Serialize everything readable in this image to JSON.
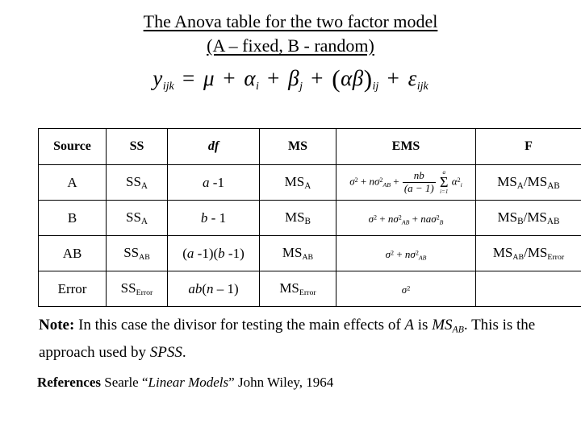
{
  "slide": {
    "title_line1": "The Anova table for the two factor model",
    "title_line2": "(A – fixed, B - random)",
    "equation_plain": "y_ijk = μ + α_i + β_j + (αβ)_ij + ε_ijk",
    "equation_parts": {
      "y": "y",
      "y_sub": "ijk",
      "equals": "=",
      "mu": "μ",
      "plus": "+",
      "alpha": "α",
      "alpha_sub": "i",
      "beta": "β",
      "beta_sub": "j",
      "open_paren": "(",
      "ab_alpha": "α",
      "ab_beta": "β",
      "close_paren": ")",
      "ab_sub": "ij",
      "epsilon": "ε",
      "epsilon_sub": "ijk"
    }
  },
  "table": {
    "headers": {
      "source": "Source",
      "ss": "SS",
      "df": "df",
      "ms": "MS",
      "ems": "EMS",
      "f": "F"
    },
    "rows": [
      {
        "source": "A",
        "ss_base": "SS",
        "ss_sub": "A",
        "df": "a -1",
        "df_italic_letter": "a",
        "df_rest": " -1",
        "ms_base": "MS",
        "ms_sub": "A",
        "ems_plain": "σ² + nσ²_AB + nb/(a-1) Σ(i=1..a) α²_i",
        "f_plain": "MS_A/MS_AB",
        "f_num_base": "MS",
        "f_num_sub": "A",
        "f_den_base": "MS",
        "f_den_sub": "AB"
      },
      {
        "source": "B",
        "ss_base": "SS",
        "ss_sub": "A",
        "df": "b - 1",
        "df_italic_letter": "b",
        "df_rest": " - 1",
        "ms_base": "MS",
        "ms_sub": "B",
        "ems_plain": "σ² + nσ²_AB + naσ²_B",
        "f_plain": "MS_B/MS_AB",
        "f_num_base": "MS",
        "f_num_sub": "B",
        "f_den_base": "MS",
        "f_den_sub": "AB"
      },
      {
        "source": "AB",
        "ss_base": "SS",
        "ss_sub": "AB",
        "df": "(a -1)(b -1)",
        "ms_base": "MS",
        "ms_sub": "AB",
        "ems_plain": "σ² + nσ²_AB",
        "f_plain": "MS_AB/MS_Error",
        "f_num_base": "MS",
        "f_num_sub": "AB",
        "f_den_base": "MS",
        "f_den_sub": "Error"
      },
      {
        "source": "Error",
        "ss_base": "SS",
        "ss_sub": "Error",
        "df": "ab(n – 1)",
        "ms_base": "MS",
        "ms_sub": "Error",
        "ems_plain": "σ²",
        "f_plain": ""
      }
    ],
    "math_symbols": {
      "sigma": "σ",
      "alpha": "α",
      "sum": "Σ",
      "sup2": "2",
      "n": "n",
      "nb": "nb",
      "na": "na",
      "a_minus_1": "(a − 1)",
      "sum_lower": "i=1",
      "sum_upper": "a",
      "sub_AB": "AB",
      "sub_B": "B",
      "sub_i": "i"
    }
  },
  "note": {
    "label": "Note:",
    "text_part1": " In this case the divisor for testing the main effects of ",
    "emphasis_a": "A",
    "text_part2": " is ",
    "ms_base": "MS",
    "ms_sub": "AB",
    "text_part3": ". This is the approach used by ",
    "emphasis_spss": "SPSS",
    "text_part4": "."
  },
  "references": {
    "label": "References",
    "author": " Searle “",
    "work": "Linear Models",
    "publisher": "” John Wiley, 1964"
  }
}
